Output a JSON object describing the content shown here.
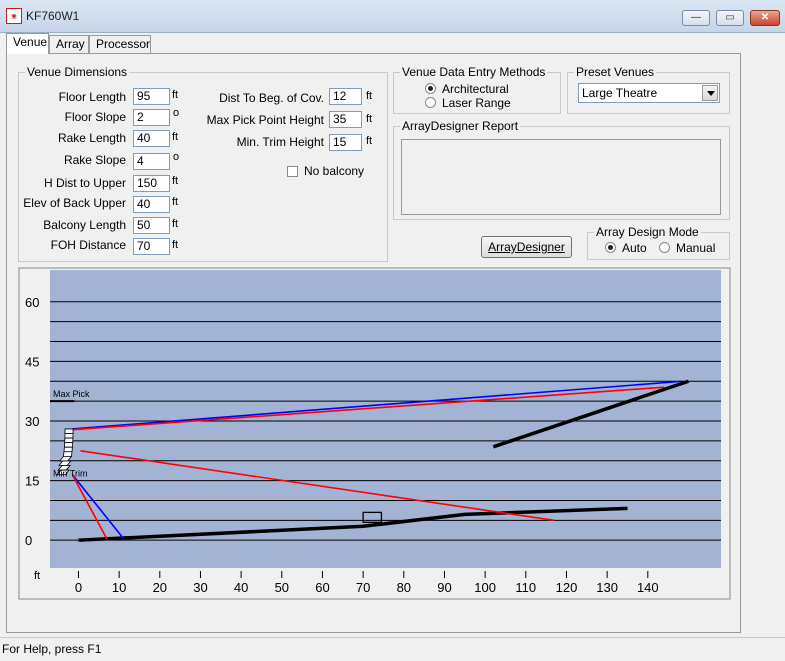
{
  "window": {
    "title": "KF760W1",
    "minimize_glyph": "—",
    "maximize_glyph": "▭",
    "close_glyph": "✕"
  },
  "tabs": [
    {
      "label": "Venue",
      "active": true
    },
    {
      "label": "Array",
      "active": false
    },
    {
      "label": "Processor",
      "active": false
    }
  ],
  "venue_dimensions": {
    "title": "Venue Dimensions",
    "fields_left": [
      {
        "label": "Floor Length",
        "value": "95",
        "unit": "ft"
      },
      {
        "label": "Floor Slope",
        "value": "2",
        "unit": "o"
      },
      {
        "label": "Rake Length",
        "value": "40",
        "unit": "ft"
      },
      {
        "label": "Rake Slope",
        "value": "4",
        "unit": "o"
      },
      {
        "label": "H Dist to Upper",
        "value": "150",
        "unit": "ft"
      },
      {
        "label": "Elev of Back Upper",
        "value": "40",
        "unit": "ft"
      },
      {
        "label": "Balcony Length",
        "value": "50",
        "unit": "ft"
      },
      {
        "label": "FOH Distance",
        "value": "70",
        "unit": "ft"
      }
    ],
    "fields_right": [
      {
        "label": "Dist To Beg. of Cov.",
        "value": "12",
        "unit": "ft"
      },
      {
        "label": "Max Pick Point Height",
        "value": "35",
        "unit": "ft"
      },
      {
        "label": "Min. Trim Height",
        "value": "15",
        "unit": "ft"
      }
    ],
    "no_balcony": {
      "label": "No balcony",
      "checked": false
    }
  },
  "entry_methods": {
    "title": "Venue Data Entry Methods",
    "options": [
      {
        "label": "Architectural",
        "selected": true
      },
      {
        "label": "Laser Range",
        "selected": false
      }
    ]
  },
  "preset_venues": {
    "title": "Preset Venues",
    "selected": "Large Theatre"
  },
  "report": {
    "title": "ArrayDesigner Report"
  },
  "array_designer_button": {
    "label": "ArrayDesigner"
  },
  "array_design_mode": {
    "title": "Array Design Mode",
    "options": [
      {
        "label": "Auto",
        "selected": true
      },
      {
        "label": "Manual",
        "selected": false
      }
    ]
  },
  "status": {
    "text": "For Help, press F1"
  },
  "colors": {
    "plot_bg": "#a3b3d3",
    "grid": "#000000",
    "coverage_top": "#0000ff",
    "coverage_bottom": "#ff0000",
    "venue": "#000000"
  },
  "chart_data": {
    "type": "line",
    "xlabel": "ft",
    "ylabel": "",
    "xlim": [
      -7,
      158
    ],
    "ylim": [
      -7,
      68
    ],
    "x_ticks": [
      0,
      10,
      20,
      30,
      40,
      50,
      60,
      70,
      80,
      90,
      100,
      110,
      120,
      130,
      140
    ],
    "y_ticks": [
      0,
      15,
      30,
      45,
      60
    ],
    "grid_y_step": 5,
    "annotations": [
      {
        "text": "Max Pick",
        "x": -7,
        "y": 35
      },
      {
        "text": "Min Trim",
        "x": -7,
        "y": 15
      }
    ],
    "venue_geometry": {
      "floor": [
        [
          0,
          0
        ],
        [
          70,
          3.5
        ],
        [
          95,
          6.5
        ],
        [
          135,
          8
        ]
      ],
      "balcony": [
        [
          102,
          23.5
        ],
        [
          150,
          40
        ]
      ],
      "max_pick_marker": [
        [
          -7,
          35
        ],
        [
          -1,
          35
        ]
      ],
      "mix_position": {
        "x": 70,
        "y": 4.5,
        "width": 4.5,
        "height": 2.5
      }
    },
    "series": [
      {
        "name": "",
        "color": "#0000ff",
        "points": [
          [
            -1.5,
            28
          ],
          [
            148.5,
            40
          ]
        ]
      },
      {
        "name": "",
        "color": "#ff0000",
        "points": [
          [
            -1.5,
            27.8
          ],
          [
            144,
            38.5
          ]
        ]
      },
      {
        "name": "",
        "color": "#ff0000",
        "points": [
          [
            0.5,
            22.5
          ],
          [
            117,
            5
          ]
        ]
      },
      {
        "name": "",
        "color": "#0000ff",
        "points": [
          [
            -1.5,
            16.5
          ],
          [
            11,
            0.5
          ]
        ]
      },
      {
        "name": "",
        "color": "#ff0000",
        "points": [
          [
            -1.5,
            16.5
          ],
          [
            7,
            0.3
          ]
        ]
      }
    ],
    "array_element_count": 10
  }
}
